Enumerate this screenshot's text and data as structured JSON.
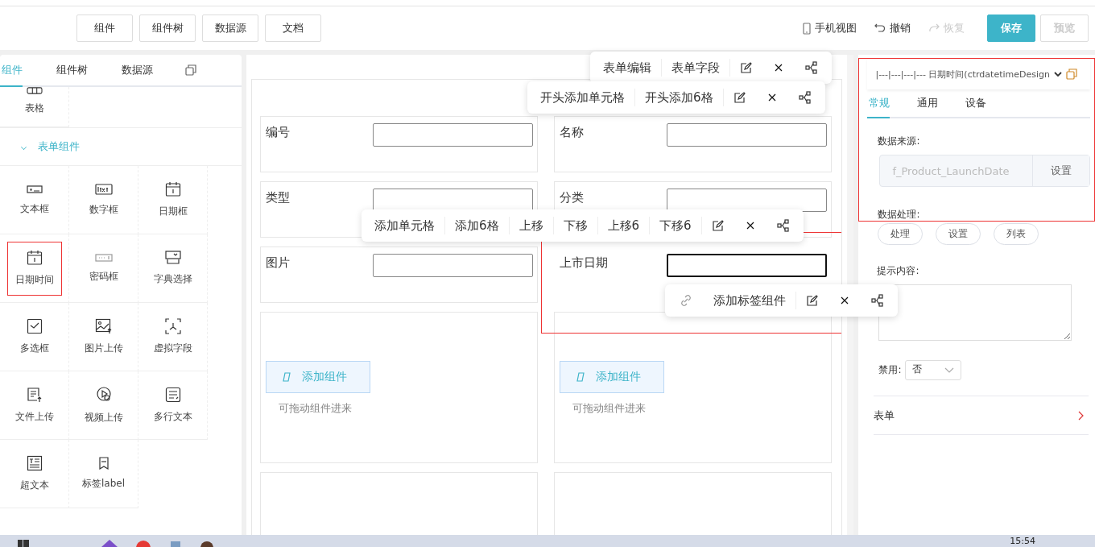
{
  "toolbar": {
    "left_buttons": [
      "组件",
      "组件树",
      "数据源",
      "文档"
    ],
    "mobile_view": "手机视图",
    "undo": {
      "label": "撤销",
      "disabled": false
    },
    "redo": {
      "label": "恢复",
      "disabled": true
    },
    "save": {
      "label": "保存",
      "disabled": false
    },
    "preview": {
      "label": "预览",
      "disabled": true
    }
  },
  "left_panel": {
    "tabs": [
      {
        "label": "组件",
        "selected": true
      },
      {
        "label": "组件树",
        "selected": false
      },
      {
        "label": "数据源",
        "selected": false
      }
    ],
    "top_items": [
      {
        "label": "表格",
        "kind": "table",
        "selected": false
      }
    ],
    "section": {
      "label": "表单组件",
      "expanded": true
    },
    "items": [
      {
        "label": "文本框",
        "kind": "text",
        "selected": false
      },
      {
        "label": "数字框",
        "kind": "number",
        "selected": false
      },
      {
        "label": "日期框",
        "kind": "date",
        "selected": false
      },
      {
        "label": "日期时间",
        "kind": "date",
        "selected": true
      },
      {
        "label": "密码框",
        "kind": "password",
        "selected": false
      },
      {
        "label": "字典选择",
        "kind": "dict",
        "selected": false
      },
      {
        "label": "多选框",
        "kind": "checkbox",
        "selected": false
      },
      {
        "label": "图片上传",
        "kind": "image",
        "selected": false
      },
      {
        "label": "虚拟字段",
        "kind": "virtual",
        "selected": false
      },
      {
        "label": "文件上传",
        "kind": "file",
        "selected": false
      },
      {
        "label": "视频上传",
        "kind": "video",
        "selected": false
      },
      {
        "label": "多行文本",
        "kind": "textarea",
        "selected": false
      },
      {
        "label": "超文本",
        "kind": "rich",
        "selected": false
      },
      {
        "label": "标签label",
        "kind": "tag",
        "selected": false
      }
    ]
  },
  "canvas": {
    "rows": [
      {
        "kind": "fields",
        "cells": [
          {
            "label": "编号",
            "selected": false,
            "focused": false
          },
          {
            "label": "名称",
            "selected": false,
            "focused": false
          }
        ]
      },
      {
        "kind": "fields",
        "cells": [
          {
            "label": "类型",
            "selected": false,
            "focused": false
          },
          {
            "label": "分类",
            "selected": false,
            "focused": false
          }
        ]
      },
      {
        "kind": "fields",
        "cells": [
          {
            "label": "图片",
            "selected": false,
            "focused": false
          },
          {
            "label": "上市日期",
            "selected": true,
            "focused": true
          }
        ]
      },
      {
        "kind": "containers",
        "cells": [
          {
            "button": "添加组件",
            "hint": "可拖动组件进来"
          },
          {
            "button": "添加组件",
            "hint": "可拖动组件进来"
          }
        ]
      },
      {
        "kind": "empty",
        "cells": [
          {},
          {}
        ]
      }
    ],
    "floating_toolbars": [
      {
        "items": [
          {
            "kind": "text",
            "label": "表单编辑"
          },
          {
            "kind": "text",
            "label": "表单字段"
          },
          {
            "kind": "edit"
          },
          {
            "kind": "close"
          },
          {
            "kind": "tree"
          }
        ]
      },
      {
        "items": [
          {
            "kind": "text",
            "label": "开头添加单元格"
          },
          {
            "kind": "text",
            "label": "开头添加6格"
          },
          {
            "kind": "edit"
          },
          {
            "kind": "close"
          },
          {
            "kind": "tree"
          }
        ]
      },
      {
        "items": [
          {
            "kind": "text",
            "label": "添加单元格"
          },
          {
            "kind": "text",
            "label": "添加6格"
          },
          {
            "kind": "text",
            "label": "上移"
          },
          {
            "kind": "text",
            "label": "下移"
          },
          {
            "kind": "text",
            "label": "上移6"
          },
          {
            "kind": "text",
            "label": "下移6"
          },
          {
            "kind": "edit"
          },
          {
            "kind": "close"
          },
          {
            "kind": "tree"
          }
        ]
      },
      {
        "items": [
          {
            "kind": "link"
          },
          {
            "kind": "text",
            "label": "添加标签组件"
          },
          {
            "kind": "edit"
          },
          {
            "kind": "close"
          },
          {
            "kind": "tree"
          }
        ]
      }
    ]
  },
  "right_panel": {
    "component_select": "|---|---|---|--- 日期时间(ctrdatetimeDesign",
    "tabs": [
      {
        "label": "常规",
        "selected": true
      },
      {
        "label": "通用",
        "selected": false
      },
      {
        "label": "设备",
        "selected": false
      }
    ],
    "data_source": {
      "label": "数据来源:",
      "value": "f_Product_LaunchDate",
      "button": "设置"
    },
    "data_processing": {
      "label": "数据处理:",
      "buttons": [
        "处理",
        "设置",
        "列表"
      ]
    },
    "hint_content": {
      "label": "提示内容:"
    },
    "disabled_select": {
      "label": "禁用:",
      "value": "否"
    },
    "form_link": "表单"
  },
  "taskbar": {
    "time": "15:54"
  }
}
